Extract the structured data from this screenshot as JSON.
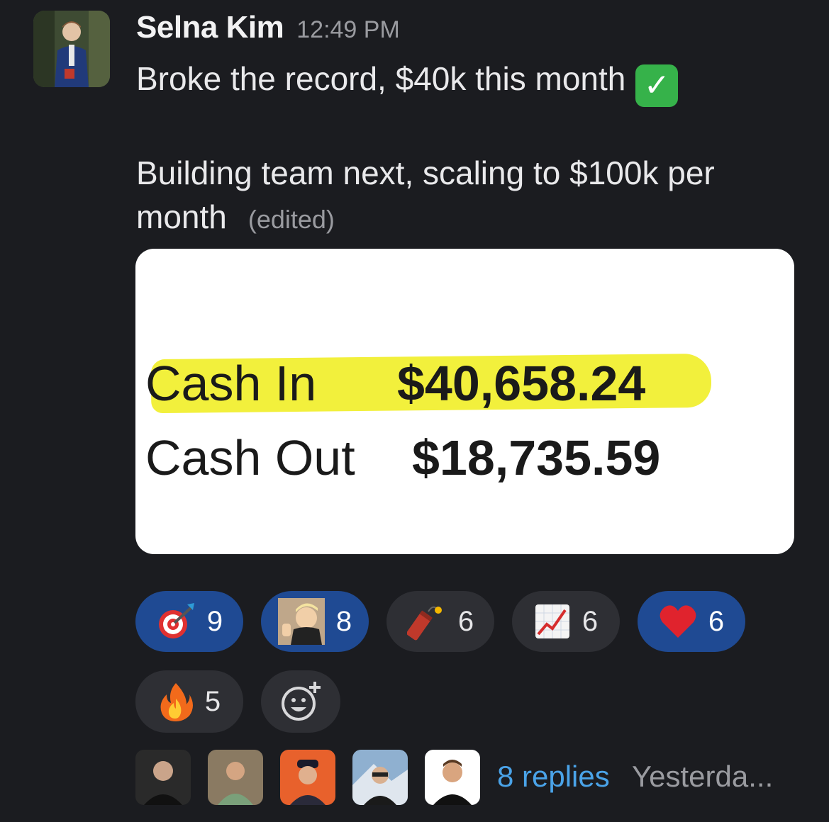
{
  "message": {
    "author": "Selna Kim",
    "time": "12:49 PM",
    "line1": "Broke the record, $40k this month",
    "line2": "Building team next, scaling to $100k per month",
    "edited_label": "(edited)",
    "check_icon": "white-check-mark-icon"
  },
  "attachment": {
    "rows": [
      {
        "label": "Cash In",
        "value": "$40,658.24",
        "highlighted": true
      },
      {
        "label": "Cash Out",
        "value": "$18,735.59",
        "highlighted": false
      }
    ],
    "highlight_color": "#f2f03c"
  },
  "reactions": [
    {
      "emoji": "direct-hit-icon",
      "count": "9",
      "active": true
    },
    {
      "emoji": "custom-face-thumbs-up-icon",
      "count": "8",
      "active": true
    },
    {
      "emoji": "firecracker-icon",
      "count": "6",
      "active": false
    },
    {
      "emoji": "chart-increasing-icon",
      "count": "6",
      "active": false
    },
    {
      "emoji": "red-heart-icon",
      "count": "6",
      "active": true
    },
    {
      "emoji": "fire-icon",
      "count": "5",
      "active": false
    }
  ],
  "thread": {
    "replies_label": "8 replies",
    "last_reply": "Yesterda..."
  },
  "colors": {
    "background": "#1b1c20",
    "pill": "#2e2f34",
    "pill_active": "#1f4a93",
    "link": "#4aa3e8",
    "muted": "#9a9ba0"
  }
}
